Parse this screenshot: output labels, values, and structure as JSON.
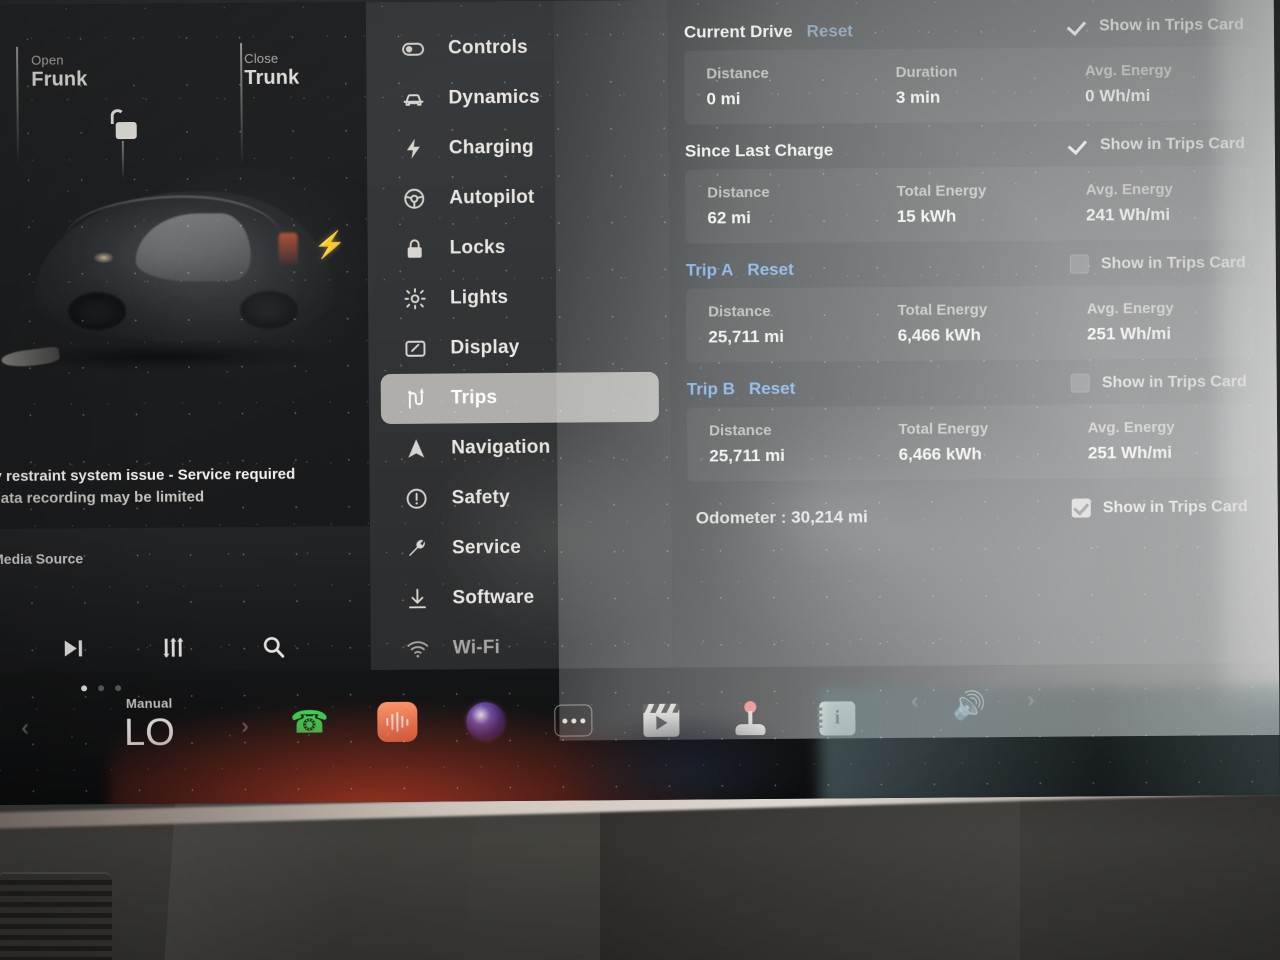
{
  "vehicle_panel": {
    "frunk": {
      "action": "Open",
      "target": "Frunk"
    },
    "trunk": {
      "action": "Close",
      "target": "Trunk"
    },
    "lock_icon": "unlocked-padlock-icon",
    "charge_icon": "lightning-bolt-icon",
    "alert": {
      "line1": "y restraint system issue - Service required",
      "line2": "data recording may be limited"
    },
    "media_source_label": "Media Source",
    "media_buttons": [
      {
        "name": "skip-next-icon",
        "glyph": "▶❘"
      },
      {
        "name": "equalizer-icon",
        "glyph": "❙❙❙"
      },
      {
        "name": "search-icon",
        "glyph": "⌕"
      }
    ]
  },
  "sidebar": {
    "items": [
      {
        "label": "Controls",
        "icon": "toggle-switch-icon",
        "active": false,
        "dim": false
      },
      {
        "label": "Dynamics",
        "icon": "car-icon",
        "active": false,
        "dim": false
      },
      {
        "label": "Charging",
        "icon": "lightning-bolt-icon",
        "active": false,
        "dim": false
      },
      {
        "label": "Autopilot",
        "icon": "steering-wheel-icon",
        "active": false,
        "dim": false
      },
      {
        "label": "Locks",
        "icon": "padlock-icon",
        "active": false,
        "dim": false
      },
      {
        "label": "Lights",
        "icon": "sun-brightness-icon",
        "active": false,
        "dim": false
      },
      {
        "label": "Display",
        "icon": "display-screen-icon",
        "active": false,
        "dim": false
      },
      {
        "label": "Trips",
        "icon": "winding-road-icon",
        "active": true,
        "dim": false
      },
      {
        "label": "Navigation",
        "icon": "navigation-arrow-icon",
        "active": false,
        "dim": false
      },
      {
        "label": "Safety",
        "icon": "alert-circle-icon",
        "active": false,
        "dim": false
      },
      {
        "label": "Service",
        "icon": "wrench-icon",
        "active": false,
        "dim": false
      },
      {
        "label": "Software",
        "icon": "download-icon",
        "active": false,
        "dim": false
      },
      {
        "label": "Wi-Fi",
        "icon": "wifi-icon",
        "active": false,
        "dim": true
      }
    ]
  },
  "trips": {
    "show_in_trips_card_label": "Show in Trips Card",
    "reset_label": "Reset",
    "sections": [
      {
        "title": "Current Drive",
        "title_is_link": false,
        "has_reset": true,
        "reset_faded": true,
        "checkbox_state": "checked",
        "stats": [
          {
            "label": "Distance",
            "value": "0 mi"
          },
          {
            "label": "Duration",
            "value": "3 min"
          },
          {
            "label": "Avg. Energy",
            "value": "0 Wh/mi"
          }
        ]
      },
      {
        "title": "Since Last Charge",
        "title_is_link": false,
        "has_reset": false,
        "reset_faded": false,
        "checkbox_state": "checked",
        "stats": [
          {
            "label": "Distance",
            "value": "62 mi"
          },
          {
            "label": "Total Energy",
            "value": "15 kWh"
          },
          {
            "label": "Avg. Energy",
            "value": "241 Wh/mi"
          }
        ]
      },
      {
        "title": "Trip A",
        "title_is_link": true,
        "has_reset": true,
        "reset_faded": false,
        "checkbox_state": "unchecked",
        "stats": [
          {
            "label": "Distance",
            "value": "25,711 mi"
          },
          {
            "label": "Total Energy",
            "value": "6,466 kWh"
          },
          {
            "label": "Avg. Energy",
            "value": "251 Wh/mi"
          }
        ]
      },
      {
        "title": "Trip B",
        "title_is_link": true,
        "has_reset": true,
        "reset_faded": false,
        "checkbox_state": "unchecked",
        "stats": [
          {
            "label": "Distance",
            "value": "25,711 mi"
          },
          {
            "label": "Total Energy",
            "value": "6,466 kWh"
          },
          {
            "label": "Avg. Energy",
            "value": "251 Wh/mi"
          }
        ]
      }
    ],
    "odometer": {
      "label": "Odometer :",
      "value": "30,214 mi",
      "checkbox_state": "checked-filled"
    }
  },
  "taskbar": {
    "climate": {
      "mode": "Manual",
      "temperature": "LO"
    },
    "page_dots": 3,
    "active_dot": 0,
    "icons": [
      {
        "name": "phone-icon",
        "label": "Phone"
      },
      {
        "name": "media-icon",
        "label": "Media"
      },
      {
        "name": "camera-icon",
        "label": "Camera"
      },
      {
        "name": "more-dots-icon",
        "label": "More"
      },
      {
        "name": "theater-icon",
        "label": "Theater"
      },
      {
        "name": "arcade-icon",
        "label": "Arcade"
      },
      {
        "name": "toybox-icon",
        "label": "Toybox"
      }
    ],
    "volume_icon": "speaker-volume-icon"
  },
  "colors": {
    "accent_blue": "#6fa8e8",
    "active_menu_bg": "#ccc9c4",
    "text_primary": "#f3f1ee",
    "text_secondary": "#b6b3af",
    "phone_green": "#2fe05b",
    "media_orange": "#f4724a"
  }
}
